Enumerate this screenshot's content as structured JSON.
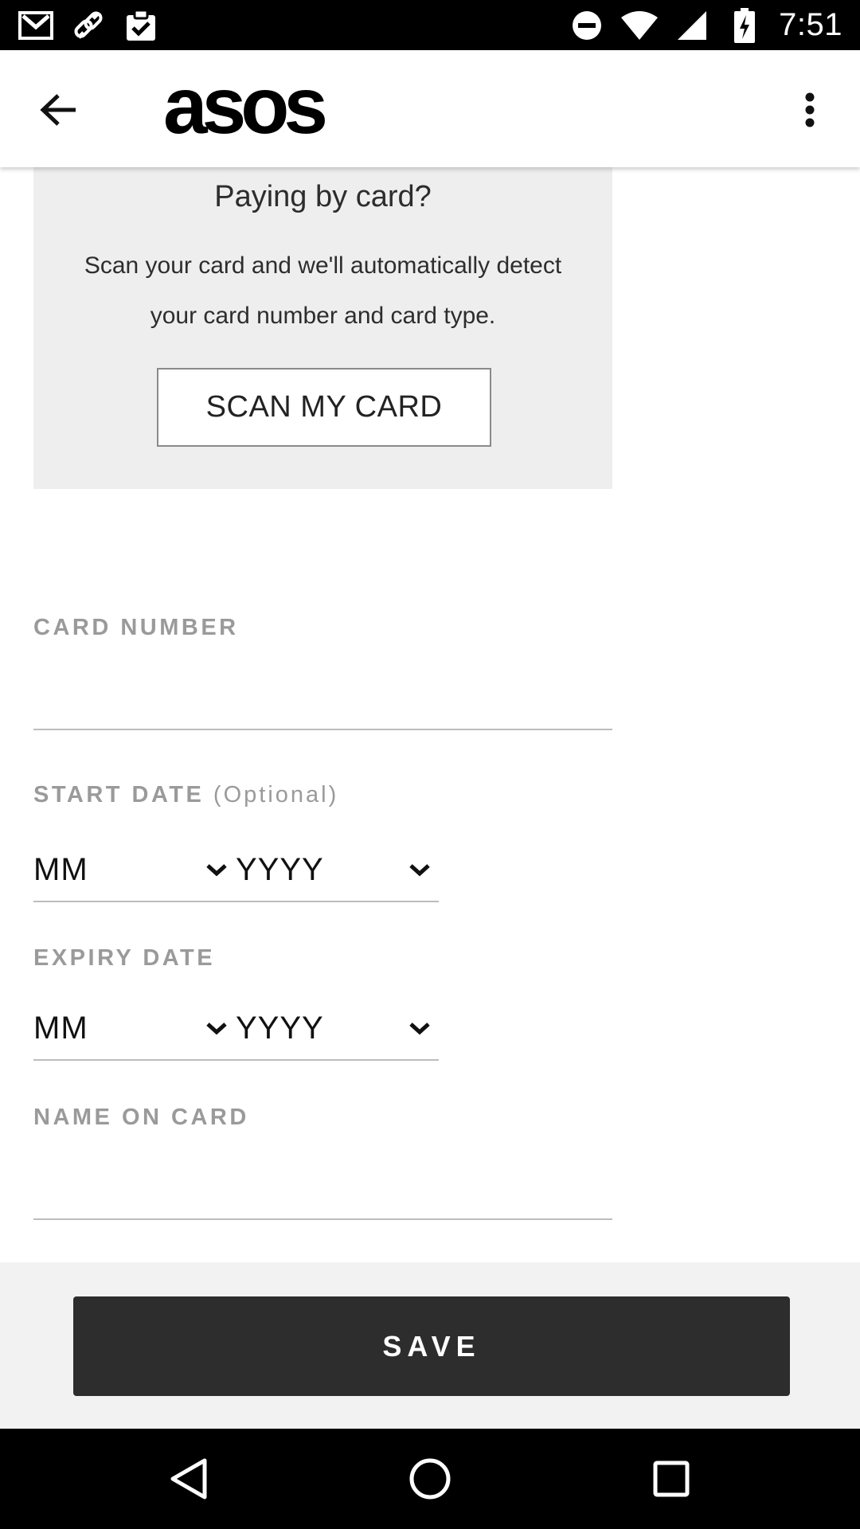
{
  "status_bar": {
    "time": "7:51",
    "left_icons": [
      "gmail-icon",
      "link-icon",
      "clipboard-check-icon"
    ],
    "right_icons": [
      "do-not-disturb-icon",
      "wifi-icon",
      "signal-icon",
      "battery-charging-icon"
    ]
  },
  "app_bar": {
    "logo": "asos",
    "back_icon": "arrow-back-icon",
    "menu_icon": "more-vert-icon"
  },
  "scan_panel": {
    "title": "Paying by card?",
    "description_line1": "Scan your card and we'll automatically detect",
    "description_line2": "your card number and card type.",
    "button_label": "SCAN MY CARD"
  },
  "form": {
    "card_number": {
      "label": "CARD NUMBER",
      "value": "",
      "placeholder": ""
    },
    "start_date": {
      "label": "START DATE",
      "optional": "(Optional)",
      "month": "MM",
      "year": "YYYY"
    },
    "expiry_date": {
      "label": "EXPIRY DATE",
      "month": "MM",
      "year": "YYYY"
    },
    "name_on_card": {
      "label": "NAME ON CARD",
      "value": "",
      "placeholder": ""
    }
  },
  "save_button": {
    "label": "SAVE"
  },
  "nav_bar": {
    "icons": [
      "nav-back-icon",
      "nav-home-icon",
      "nav-recents-icon"
    ]
  },
  "colors": {
    "panel_bg": "#eeeeee",
    "label": "#9a9a9a",
    "save_bg": "#2d2d2d",
    "save_area_bg": "#f2f2f2"
  }
}
